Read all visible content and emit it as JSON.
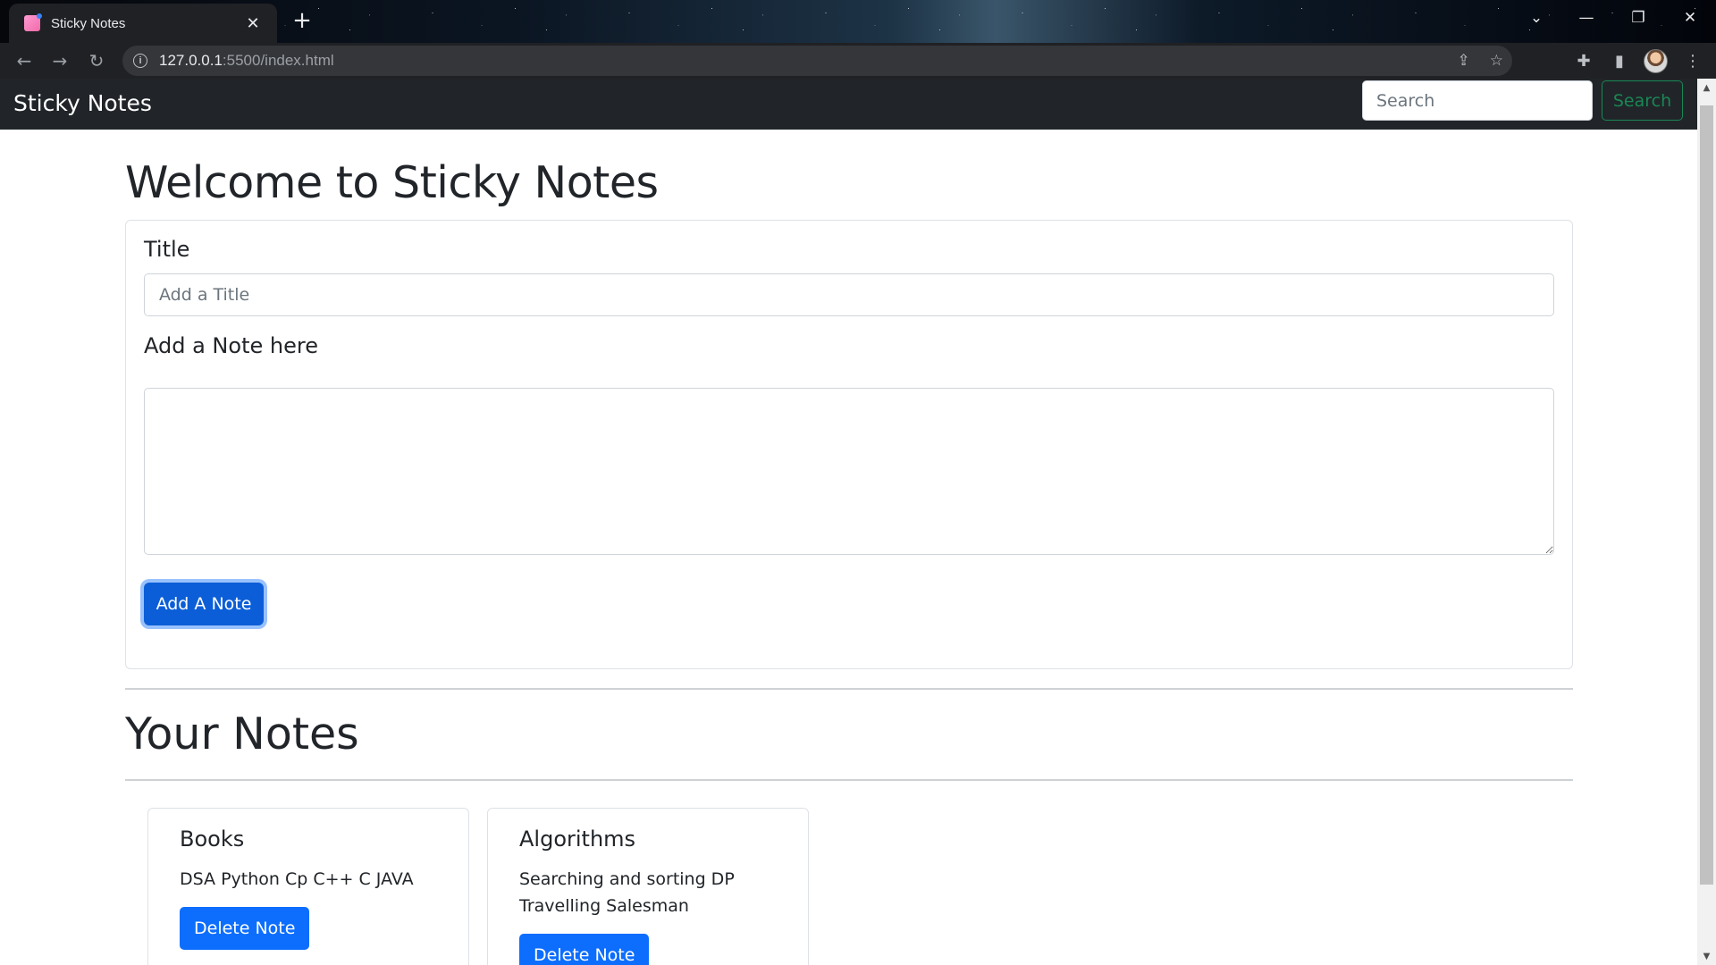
{
  "browser": {
    "tab_title": "Sticky Notes",
    "url_host": "127.0.0.1",
    "url_rest": ":5500/index.html",
    "icons": [
      "back-arrow-icon",
      "forward-arrow-icon",
      "reload-icon",
      "info-icon",
      "share-icon",
      "star-icon",
      "extensions-icon",
      "side-panel-icon",
      "kebab-menu-icon"
    ]
  },
  "navbar": {
    "brand": "Sticky Notes",
    "search_placeholder": "Search",
    "search_button": "Search"
  },
  "main": {
    "heading": "Welcome to Sticky Notes",
    "title_label": "Title",
    "title_placeholder": "Add a Title",
    "note_label": "Add a Note here",
    "note_value": "",
    "add_button": "Add A Note",
    "notes_heading": "Your Notes"
  },
  "notes": [
    {
      "title": "Books",
      "text": "DSA Python Cp C++ C JAVA",
      "button": "Delete Note"
    },
    {
      "title": "Algorithms",
      "text": "Searching and sorting DP Travelling Salesman",
      "button": "Delete Note"
    }
  ],
  "colors": {
    "navbar_bg": "#212529",
    "primary": "#0d6efd",
    "success": "#198754"
  }
}
